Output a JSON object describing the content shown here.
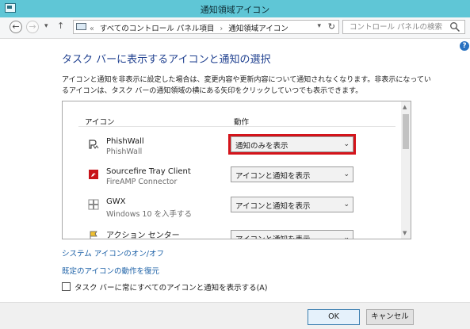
{
  "window": {
    "title": "通知領域アイコン"
  },
  "nav": {
    "back_label": "←",
    "forward_label": "→",
    "history_label": "▾",
    "up_label": "↑",
    "breadcrumb": [
      "すべてのコントロール パネル項目",
      "通知領域アイコン"
    ],
    "overflow_label": "«",
    "search_placeholder": "コントロール パネルの検索"
  },
  "help_label": "?",
  "main": {
    "heading": "タスク バーに表示するアイコンと通知の選択",
    "description": "アイコンと通知を非表示に設定した場合は、変更内容や更新内容について通知されなくなります。非表示になっているアイコンは、タスク バーの通知領域の横にある矢印をクリックしていつでも表示できます。",
    "columns": {
      "icon": "アイコン",
      "behavior": "動作"
    },
    "rows": [
      {
        "name": "PhishWall",
        "sub": "PhishWall",
        "behavior": "通知のみを表示",
        "highlighted": true
      },
      {
        "name": "Sourcefire Tray Client",
        "sub": "FireAMP Connector",
        "behavior": "アイコンと通知を表示"
      },
      {
        "name": "GWX",
        "sub": "Windows 10 を入手する",
        "behavior": "アイコンと通知を表示"
      },
      {
        "name": "アクション センター",
        "sub": "",
        "behavior": "アイコンと通知を表示"
      }
    ],
    "links": {
      "system_icons": "システム アイコンのオン/オフ",
      "restore": "既定のアイコンの動作を復元"
    },
    "always_show_checkbox": {
      "label": "タスク バーに常にすべてのアイコンと通知を表示する(A)",
      "checked": false
    }
  },
  "footer": {
    "ok": "OK",
    "cancel": "キャンセル"
  },
  "colors": {
    "titlebar": "#5fc6d6",
    "heading": "#1e3f8f",
    "link": "#1a5fa6",
    "highlight": "#d4141b"
  },
  "icons": [
    "back-icon",
    "forward-icon",
    "up-icon",
    "computer-icon",
    "refresh-icon",
    "search-icon",
    "help-icon",
    "phishwall-icon",
    "sourcefire-icon",
    "windows-icon",
    "action-center-icon"
  ]
}
